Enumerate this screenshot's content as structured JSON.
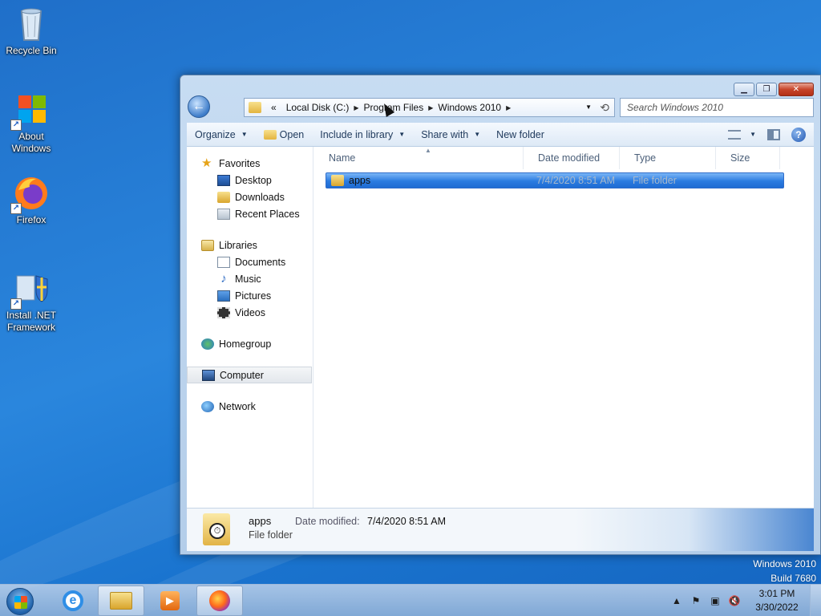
{
  "desktop": {
    "icons": [
      {
        "label": "Recycle Bin",
        "icon": "recycle-bin-icon"
      },
      {
        "label": "About Windows",
        "icon": "windows-logo-icon"
      },
      {
        "label": "Firefox",
        "icon": "firefox-icon"
      },
      {
        "label": "Install .NET Framework",
        "icon": "shield-installer-icon"
      }
    ],
    "watermark": {
      "line1": "Windows 2010",
      "line2": "Build 7680"
    }
  },
  "window": {
    "address": {
      "overflow": "«",
      "crumbs": [
        "Local Disk (C:)",
        "Program Files",
        "Windows 2010"
      ]
    },
    "search_placeholder": "Search Windows 2010",
    "toolbar": {
      "organize": "Organize",
      "open": "Open",
      "include_in_library": "Include in library",
      "share_with": "Share with",
      "new_folder": "New folder"
    },
    "nav": {
      "favorites": {
        "label": "Favorites",
        "items": [
          "Desktop",
          "Downloads",
          "Recent Places"
        ]
      },
      "libraries": {
        "label": "Libraries",
        "items": [
          "Documents",
          "Music",
          "Pictures",
          "Videos"
        ]
      },
      "homegroup": "Homegroup",
      "computer": "Computer",
      "network": "Network"
    },
    "columns": {
      "name": "Name",
      "date_modified": "Date modified",
      "type": "Type",
      "size": "Size"
    },
    "files": [
      {
        "name": "apps",
        "date_modified": "7/4/2020 8:51 AM",
        "type": "File folder",
        "selected": true
      }
    ],
    "details": {
      "name": "apps",
      "type": "File folder",
      "date_label": "Date modified:",
      "date_value": "7/4/2020 8:51 AM"
    }
  },
  "taskbar": {
    "clock_time": "3:01 PM",
    "clock_date": "3/30/2022",
    "buttons": [
      "internet-explorer-icon",
      "windows-explorer-icon",
      "media-player-icon",
      "firefox-icon"
    ],
    "active_button": "windows-explorer-icon"
  }
}
